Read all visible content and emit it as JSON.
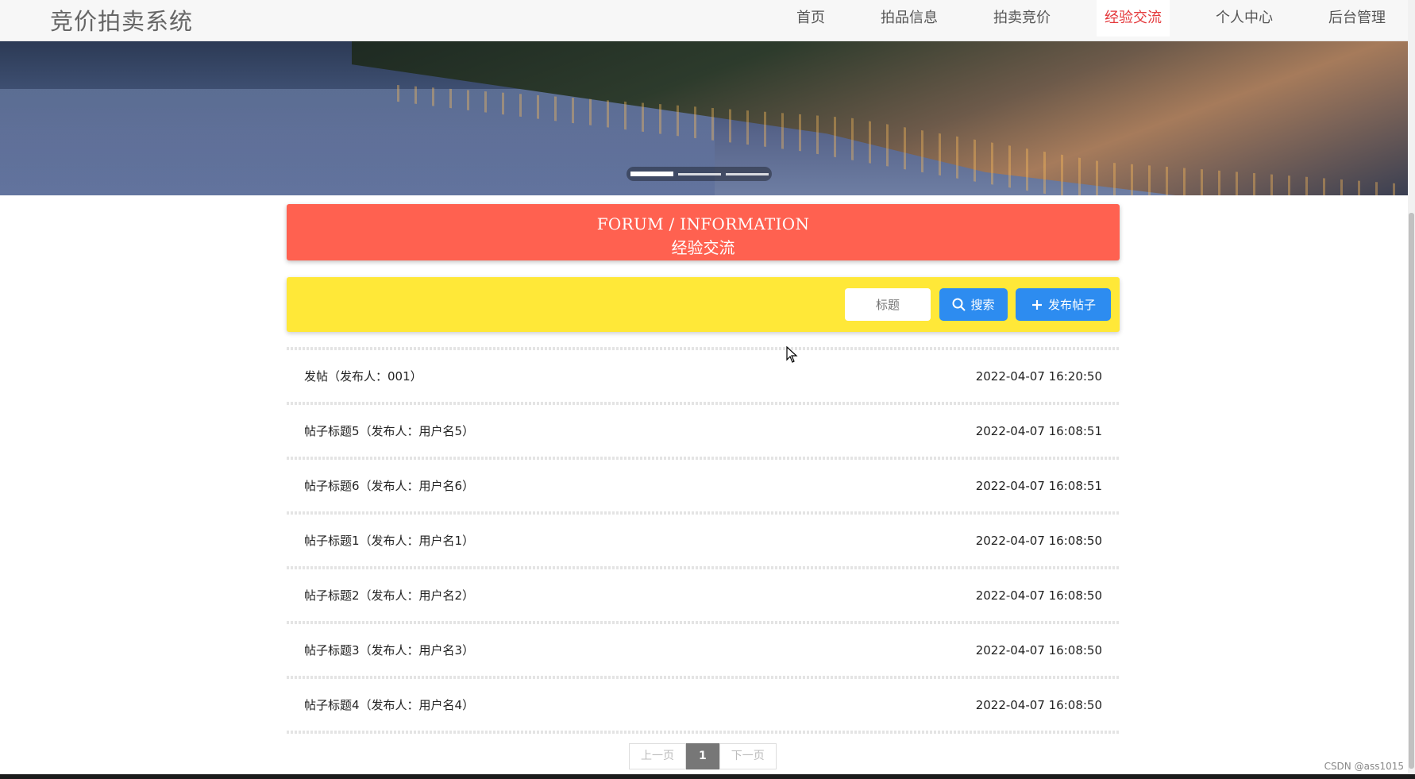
{
  "header": {
    "brand": "竞价拍卖系统",
    "nav": [
      {
        "label": "首页",
        "active": false
      },
      {
        "label": "拍品信息",
        "active": false
      },
      {
        "label": "拍卖竞价",
        "active": false
      },
      {
        "label": "经验交流",
        "active": true
      },
      {
        "label": "个人中心",
        "active": false
      },
      {
        "label": "后台管理",
        "active": false
      }
    ]
  },
  "banner": {
    "slides": 3,
    "active_slide": 1
  },
  "forum": {
    "title_en": "FORUM / INFORMATION",
    "title_cn": "经验交流"
  },
  "search": {
    "placeholder": "标题",
    "search_label": "搜索",
    "post_label": "发布帖子"
  },
  "posts": [
    {
      "title": "发帖（发布人：001）",
      "time": "2022-04-07 16:20:50"
    },
    {
      "title": "帖子标题5（发布人：用户名5）",
      "time": "2022-04-07 16:08:51"
    },
    {
      "title": "帖子标题6（发布人：用户名6）",
      "time": "2022-04-07 16:08:51"
    },
    {
      "title": "帖子标题1（发布人：用户名1）",
      "time": "2022-04-07 16:08:50"
    },
    {
      "title": "帖子标题2（发布人：用户名2）",
      "time": "2022-04-07 16:08:50"
    },
    {
      "title": "帖子标题3（发布人：用户名3）",
      "time": "2022-04-07 16:08:50"
    },
    {
      "title": "帖子标题4（发布人：用户名4）",
      "time": "2022-04-07 16:08:50"
    }
  ],
  "pagination": {
    "prev": "上一页",
    "current": "1",
    "next": "下一页"
  },
  "watermark": "CSDN @ass1015",
  "colors": {
    "forum_header": "#ff6150",
    "search_bar": "#ffe838",
    "button": "#2d8cf0",
    "active_nav": "#e4393c"
  }
}
